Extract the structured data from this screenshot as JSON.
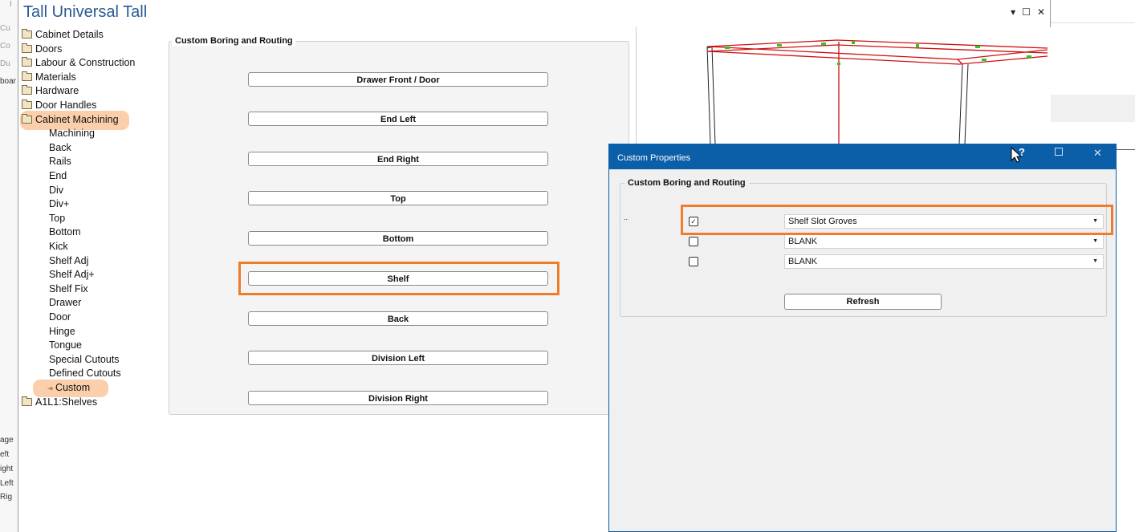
{
  "main_window": {
    "title": "Tall Universal Tall",
    "controls": {
      "dropdown": "▾",
      "maximize": "☐",
      "close": "✕"
    }
  },
  "tree": {
    "items": [
      {
        "label": "Cabinet Details",
        "folder": true
      },
      {
        "label": "Doors",
        "folder": true
      },
      {
        "label": "Labour & Construction",
        "folder": true
      },
      {
        "label": "Materials",
        "folder": true
      },
      {
        "label": "Hardware",
        "folder": true
      },
      {
        "label": "Door Handles",
        "folder": true
      },
      {
        "label": "Cabinet Machining",
        "folder": true,
        "highlighted": true
      },
      {
        "label": "Machining"
      },
      {
        "label": "Back"
      },
      {
        "label": "Rails"
      },
      {
        "label": "End"
      },
      {
        "label": "Div"
      },
      {
        "label": "Div+"
      },
      {
        "label": "Top"
      },
      {
        "label": "Bottom"
      },
      {
        "label": "Kick"
      },
      {
        "label": "Shelf Adj"
      },
      {
        "label": "Shelf Adj+"
      },
      {
        "label": "Shelf Fix"
      },
      {
        "label": "Drawer"
      },
      {
        "label": "Door"
      },
      {
        "label": "Hinge"
      },
      {
        "label": "Tongue"
      },
      {
        "label": "Special Cutouts"
      },
      {
        "label": "Defined Cutouts"
      },
      {
        "label": "Custom",
        "selected": true,
        "highlighted": true
      },
      {
        "label": "A1L1:Shelves",
        "folder": true
      }
    ]
  },
  "boring": {
    "group_title": "Custom Boring and Routing",
    "buttons": [
      "Drawer Front / Door",
      "End Left",
      "End Right",
      "Top",
      "Bottom",
      "Shelf",
      "Back",
      "Division Left",
      "Division Right"
    ],
    "highlighted_button": "Shelf"
  },
  "dialog": {
    "title": "Custom Properties",
    "group_title": "Custom Boring and Routing",
    "rows": [
      {
        "checked": true,
        "value": "Shelf Slot Groves"
      },
      {
        "checked": false,
        "value": "BLANK"
      },
      {
        "checked": false,
        "value": "BLANK"
      }
    ],
    "row_mark": "..",
    "refresh_label": "Refresh",
    "help_glyph": "?"
  },
  "background": {
    "left_fragments": [
      "I",
      "Cu",
      "Co",
      "Du",
      "boar",
      "age",
      "eft",
      "ight",
      "Left",
      "Rig"
    ]
  },
  "colors": {
    "highlight_orange": "#f07c28",
    "tree_highlight": "#fbcfab",
    "dialog_title_bar": "#0b5ea8",
    "title_blue": "#2a5a93",
    "model_red": "#d01010",
    "model_green": "#22cc22"
  }
}
